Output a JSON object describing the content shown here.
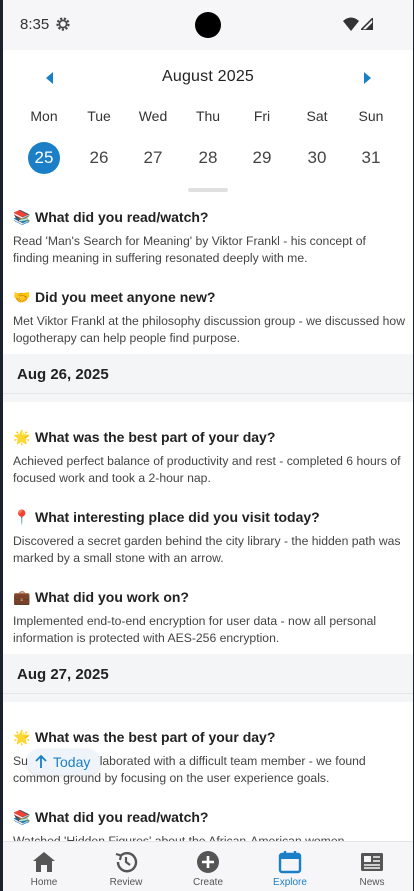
{
  "status_bar": {
    "time": "8:35"
  },
  "calendar": {
    "month_title": "August 2025",
    "days": [
      {
        "name": "Mon",
        "num": "25",
        "selected": true
      },
      {
        "name": "Tue",
        "num": "26"
      },
      {
        "name": "Wed",
        "num": "27"
      },
      {
        "name": "Thu",
        "num": "28"
      },
      {
        "name": "Fri",
        "num": "29"
      },
      {
        "name": "Sat",
        "num": "30"
      },
      {
        "name": "Sun",
        "num": "31"
      }
    ]
  },
  "feed": {
    "e1": {
      "emoji": "📚",
      "question": "What did you read/watch?",
      "answer": "Read 'Man's Search for Meaning' by Viktor Frankl - his concept of finding meaning in suffering resonated deeply with me."
    },
    "e2": {
      "emoji": "🤝",
      "question": "Did you meet anyone new?",
      "answer": "Met Viktor Frankl at the philosophy discussion group - we discussed how logotherapy can help people find purpose."
    },
    "date2": "Aug 26, 2025",
    "e3": {
      "emoji": "🌟",
      "question": "What was the best part of your day?",
      "answer": "Achieved perfect balance of productivity and rest - completed 6 hours of focused work and took a 2-hour nap."
    },
    "e4": {
      "emoji": "📍",
      "question": "What interesting place did you visit today?",
      "answer": "Discovered a secret garden behind the city library - the hidden path was marked by a small stone with an arrow."
    },
    "e5": {
      "emoji": "💼",
      "question": "What did you work on?",
      "answer": "Implemented end-to-end encryption for user data - now all personal information is protected with AES-256 encryption."
    },
    "date3": "Aug 27, 2025",
    "e6": {
      "emoji": "🌟",
      "question": "What was the best part of your day?",
      "answer": "Successfully collaborated with a difficult team member - we found common ground by focusing on the user experience goals."
    },
    "e7": {
      "emoji": "📚",
      "question": "What did you read/watch?",
      "answer": "Watched 'Hidden Figures' about the African-American women"
    }
  },
  "today_button": {
    "label": "Today"
  },
  "nav": {
    "home": "Home",
    "review": "Review",
    "create": "Create",
    "explore": "Explore",
    "news": "News"
  },
  "colors": {
    "accent": "#1a7fc7"
  }
}
